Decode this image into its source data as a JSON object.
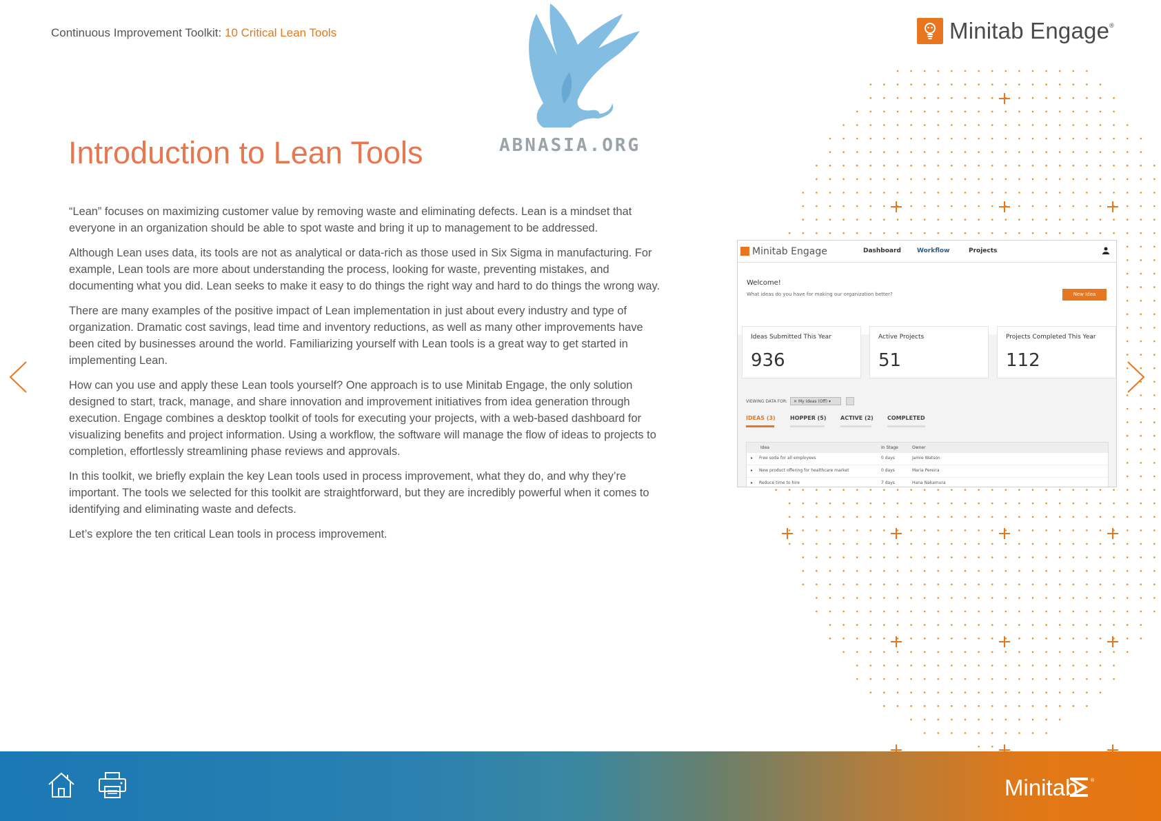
{
  "header": {
    "breadcrumb_prefix": "Continuous Improvement Toolkit: ",
    "breadcrumb_link": "10 Critical Lean Tools",
    "brand": "Minitab Engage",
    "brand_mark": "®"
  },
  "watermark": {
    "text": "ABNASIA.ORG",
    "icon": "griffin-logo"
  },
  "page": {
    "title": "Introduction to Lean Tools",
    "paragraphs": [
      "“Lean” focuses on maximizing customer value by removing waste and eliminating defects. Lean is a mindset that everyone in an organization should be able to spot waste and bring it up to management to be addressed.",
      "Although Lean uses data, its tools are not as analytical or data-rich as those used in Six Sigma in manufacturing. For example, Lean tools are more about understanding the process, looking for waste, preventing mistakes, and documenting what you did. Lean seeks to make it easy to do things the right way and hard to do things the wrong way.",
      "There are many examples of the positive impact of Lean implementation in just about every industry and type of organization. Dramatic cost savings, lead time and inventory reductions, as well as many other improvements have been cited by businesses around the world. Familiarizing yourself with Lean tools is a great way to get started in implementing Lean.",
      "How can you use and apply these Lean tools yourself? One approach is to use Minitab Engage, the only solution designed to start, track, manage, and share innovation and improvement initiatives from idea generation through execution. Engage combines a desktop toolkit of tools for executing your projects, with a web-based dashboard for visualizing benefits and project information. Using a workflow, the software will manage the flow of ideas to projects to completion, effortlessly streamlining phase reviews and approvals.",
      "In this toolkit, we briefly explain the key Lean tools used in process improvement, what they do, and why they’re important. The tools we selected for this toolkit are straightforward, but they are incredibly powerful when it comes to identifying and eliminating waste and defects.",
      "Let’s explore the ten critical Lean tools in process improvement."
    ]
  },
  "mockup": {
    "brand": "Minitab Engage",
    "tabs": [
      "Dashboard",
      "Workflow",
      "Projects"
    ],
    "welcome_title": "Welcome!",
    "welcome_sub": "What ideas do you have for making our organization better?",
    "new_idea": "New Idea",
    "stats": [
      {
        "label": "Ideas Submitted This Year",
        "value": "936"
      },
      {
        "label": "Active Projects",
        "value": "51"
      },
      {
        "label": "Projects Completed This Year",
        "value": "112"
      }
    ],
    "viewing_label": "VIEWING DATA FOR:",
    "filter": "My Ideas (Off)",
    "stages": [
      "IDEAS (3)",
      "HOPPER (5)",
      "ACTIVE (2)",
      "COMPLETED"
    ],
    "table_headers": [
      "Idea",
      "In Stage",
      "Owner"
    ],
    "rows": [
      {
        "idea": "Free soda for all employees",
        "stage": "0 days",
        "owner": "Jamie Watson"
      },
      {
        "idea": "New product offering for healthcare market",
        "stage": "0 days",
        "owner": "Maria Pereira"
      },
      {
        "idea": "Reduce time to hire",
        "stage": "7 days",
        "owner": "Hana Nakamura"
      }
    ]
  },
  "footer": {
    "brand": "Minitab",
    "brand_mark": "®"
  },
  "colors": {
    "accent": "#e8761f",
    "title": "#e8764e",
    "footer_left": "#1a78b4",
    "footer_right": "#e8760f"
  }
}
